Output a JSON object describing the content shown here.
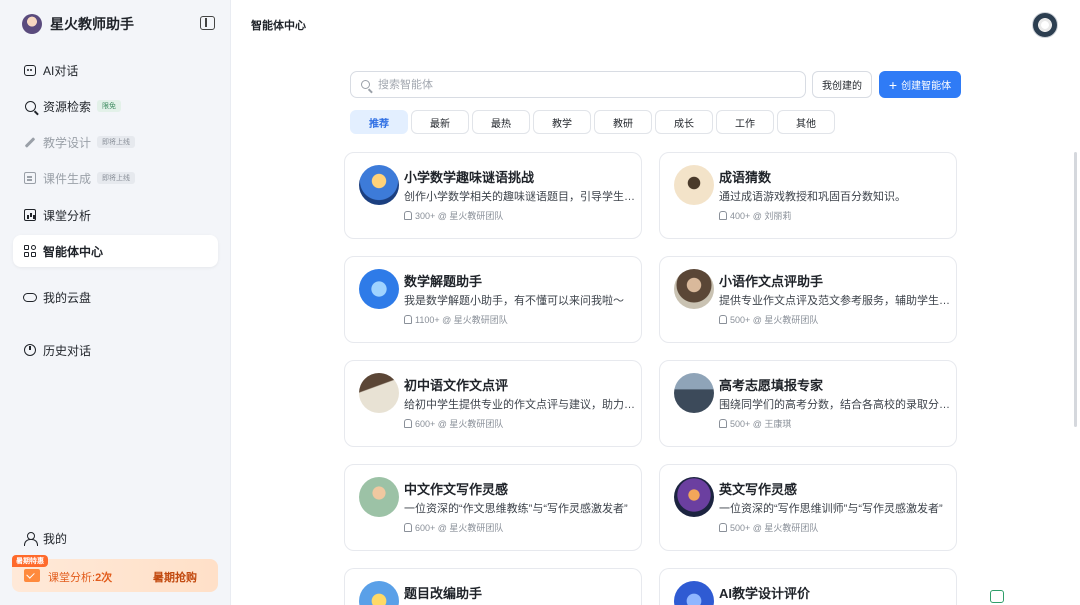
{
  "app": {
    "name": "星火教师助手"
  },
  "header": {
    "title": "智能体中心"
  },
  "sidebar": {
    "items": [
      {
        "label": "AI对话",
        "icon": "chat-icon",
        "tag": ""
      },
      {
        "label": "资源检索",
        "icon": "search-icon",
        "tag": "限免"
      },
      {
        "label": "教学设计",
        "icon": "edit-icon",
        "tag": "即将上线"
      },
      {
        "label": "课件生成",
        "icon": "document-icon",
        "tag": "即将上线"
      },
      {
        "label": "课堂分析",
        "icon": "chart-icon",
        "tag": ""
      },
      {
        "label": "智能体中心",
        "icon": "grid-icon",
        "tag": ""
      },
      {
        "label": "我的云盘",
        "icon": "cloud-icon",
        "tag": ""
      },
      {
        "label": "历史对话",
        "icon": "clock-icon",
        "tag": ""
      }
    ],
    "user_label": "我的",
    "promo": {
      "badge": "暑期特惠",
      "text_prefix": "课堂分析:",
      "count": "2次",
      "cta": "暑期抢购"
    }
  },
  "search": {
    "placeholder": "搜索智能体"
  },
  "toolbar": {
    "mine_label": "我创建的",
    "create_label": "创建智能体"
  },
  "tabs": [
    "推荐",
    "最新",
    "最热",
    "教学",
    "教研",
    "成长",
    "工作",
    "其他"
  ],
  "cards": [
    {
      "title": "小学数学趣味谜语挑战",
      "desc": "创作小学数学相关的趣味谜语题目，引导学生思考",
      "likes": "300+",
      "author": "@ 星火教研团队"
    },
    {
      "title": "成语猜数",
      "desc": "通过成语游戏教授和巩固百分数知识。",
      "likes": "400+",
      "author": "@ 刘丽莉"
    },
    {
      "title": "数学解题助手",
      "desc": "我是数学解题小助手，有不懂可以来问我啦～",
      "likes": "1100+",
      "author": "@ 星火教研团队"
    },
    {
      "title": "小语作文点评助手",
      "desc": "提供专业作文点评及范文参考服务，辅助学生提升",
      "likes": "500+",
      "author": "@ 星火教研团队"
    },
    {
      "title": "初中语文作文点评",
      "desc": "给初中学生提供专业的作文点评与建议，助力写作",
      "likes": "600+",
      "author": "@ 星火教研团队"
    },
    {
      "title": "高考志愿填报专家",
      "desc": "围绕同学们的高考分数，结合各高校的录取分数线",
      "likes": "500+",
      "author": "@ 王康琪"
    },
    {
      "title": "中文作文写作灵感",
      "desc": "一位资深的“作文思维教练”与“写作灵感激发者”",
      "likes": "600+",
      "author": "@ 星火教研团队"
    },
    {
      "title": "英文写作灵感",
      "desc": "一位资深的“写作思维训师”与“写作灵感激发者”",
      "likes": "500+",
      "author": "@ 星火教研团队"
    },
    {
      "title": "题目改编助手",
      "desc": "",
      "likes": "",
      "author": ""
    },
    {
      "title": "AI教学设计评价",
      "desc": "",
      "likes": "",
      "author": ""
    }
  ],
  "colors": {
    "accent": "#2f7bf6",
    "sidebar_bg": "#f3f5f9",
    "promo_text": "#e25c1c"
  }
}
